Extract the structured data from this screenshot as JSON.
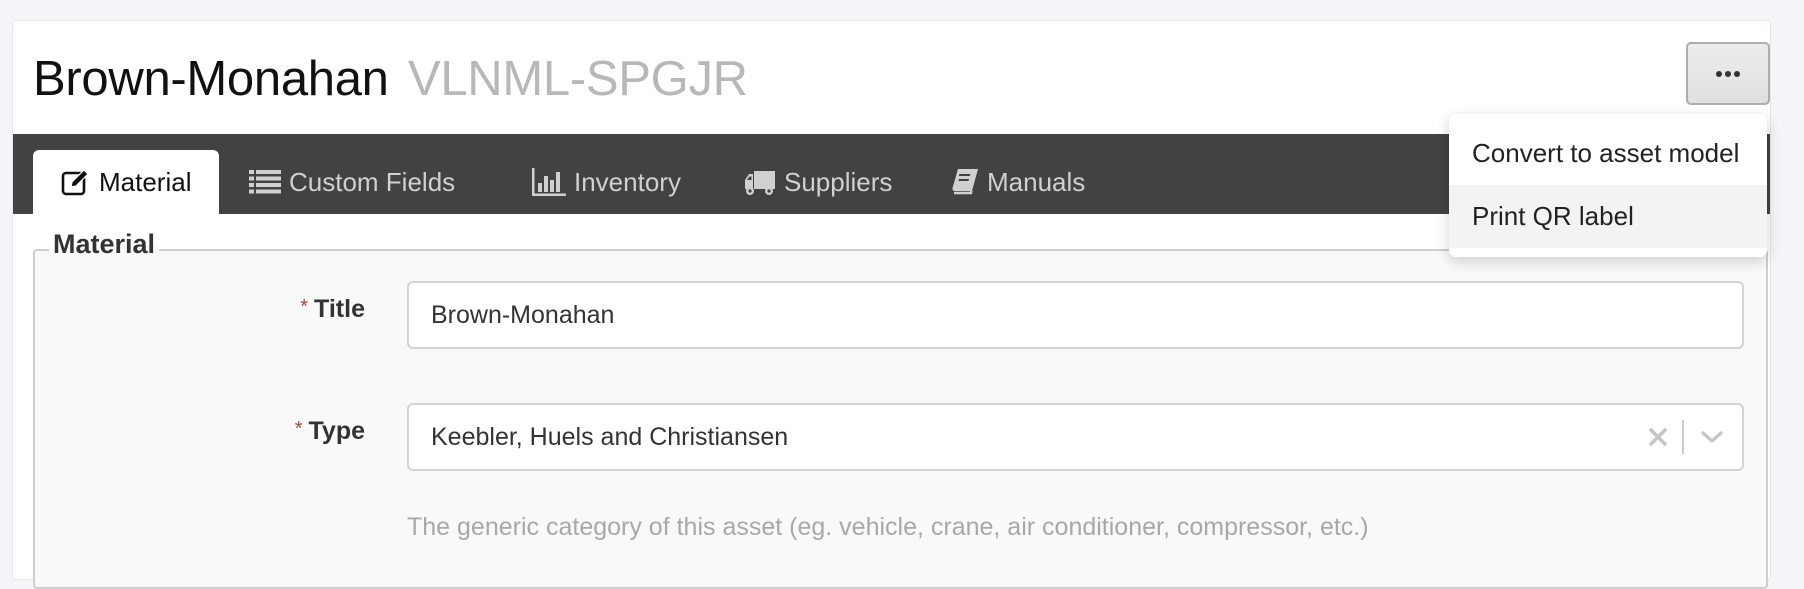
{
  "header": {
    "title": "Brown-Monahan",
    "code": "VLNML-SPGJR",
    "more_button_icon": "ellipsis-icon"
  },
  "tabs": [
    {
      "label": "Material",
      "icon": "edit-icon",
      "active": true
    },
    {
      "label": "Custom Fields",
      "icon": "list-icon",
      "active": false
    },
    {
      "label": "Inventory",
      "icon": "bar-chart-icon",
      "active": false
    },
    {
      "label": "Suppliers",
      "icon": "truck-icon",
      "active": false
    },
    {
      "label": "Manuals",
      "icon": "book-icon",
      "active": false
    }
  ],
  "dropdown": {
    "items": [
      {
        "label": "Convert to asset model"
      },
      {
        "label": "Print QR label",
        "hovered": true
      }
    ]
  },
  "form": {
    "legend": "Material",
    "required_marker": "*",
    "title_field": {
      "label": "Title",
      "value": "Brown-Monahan"
    },
    "type_field": {
      "label": "Type",
      "value": "Keebler, Huels and Christiansen",
      "help": "The generic category of this asset (eg. vehicle, crane, air conditioner, compressor, etc.)"
    }
  },
  "colors": {
    "tabbar_bg": "#424242",
    "required": "#a94442",
    "help_text": "#a8a8a8",
    "code_text": "#b8b8b8"
  }
}
